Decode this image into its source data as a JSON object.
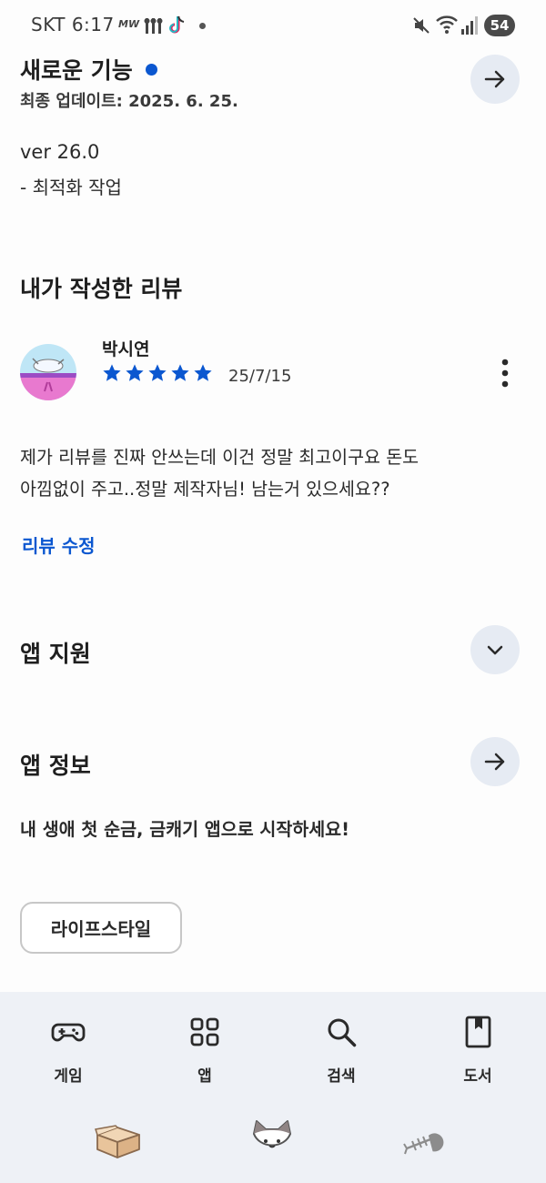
{
  "status_bar": {
    "carrier_time": "SKT 6:17",
    "mw_label": "MW",
    "battery": "54"
  },
  "whats_new": {
    "title": "새로운 기능",
    "updated": "최종 업데이트: 2025. 6. 25.",
    "version": "ver 26.0",
    "notes": "- 최적화 작업"
  },
  "my_review": {
    "heading": "내가 작성한 리뷰",
    "reviewer_name": "박시연",
    "rating": 5,
    "date": "25/7/15",
    "text_line1": "제가 리뷰를 진짜 안쓰는데 이건 정말 최고이구요 돈도",
    "text_line2": "아낌없이 주고..정말 제작자님! 남는거 있으세요??",
    "edit_label": "리뷰 수정"
  },
  "app_support": {
    "title": "앱 지원"
  },
  "app_info": {
    "title": "앱 정보",
    "description": "내 생애 첫 순금, 금캐기 앱으로 시작하세요!",
    "category_chip": "라이프스타일"
  },
  "bottom_nav": {
    "items": [
      {
        "label": "게임",
        "icon": "gamepad-icon"
      },
      {
        "label": "앱",
        "icon": "apps-grid-icon"
      },
      {
        "label": "검색",
        "icon": "search-icon"
      },
      {
        "label": "도서",
        "icon": "book-icon"
      }
    ]
  },
  "colors": {
    "accent_blue": "#0b57d0",
    "round_button_bg": "#e6ebf3",
    "nav_bg": "#eef1f6"
  }
}
